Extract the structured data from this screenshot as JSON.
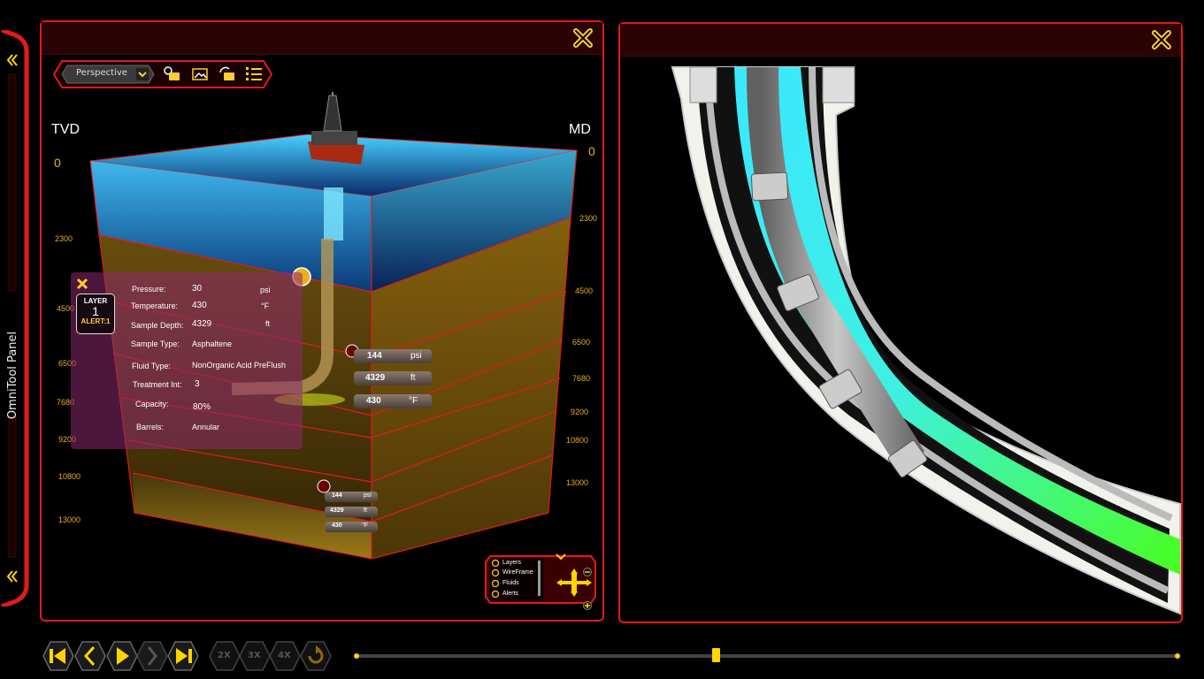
{
  "omnitool": {
    "label": "OmniTool Panel"
  },
  "left_panel": {
    "view_mode": {
      "selected": "Perspective"
    },
    "toolbar_icons": [
      "zoom-camera-icon",
      "image-icon",
      "rotate-camera-icon",
      "list-settings-icon"
    ],
    "tvd_label": "TVD",
    "md_label": "MD",
    "tvd_ticks": [
      "0",
      "2300",
      "4500",
      "6500",
      "7680",
      "9200",
      "10800",
      "13000"
    ],
    "md_ticks": [
      "0",
      "2300",
      "4500",
      "6500",
      "7680",
      "9200",
      "10800",
      "13000"
    ],
    "info_card": {
      "layer_label": "LAYER",
      "layer_number": "1",
      "alert": "ALERT:1",
      "fields": [
        {
          "label": "Pressure:",
          "value": "30",
          "unit": "psi"
        },
        {
          "label": "Temperature:",
          "value": "430",
          "unit": "°F"
        },
        {
          "label": "Sample Depth:",
          "value": "4329",
          "unit": "ft"
        },
        {
          "label": "Sample Type:",
          "value": "Asphaltene",
          "unit": ""
        },
        {
          "label": "Fluid Type:",
          "value": "NonOrganic Acid PreFlush",
          "unit": ""
        },
        {
          "label": "Treatment Int:",
          "value": "3",
          "unit": ""
        },
        {
          "label": "Capacity:",
          "value": "80%",
          "unit": ""
        },
        {
          "label": "Barrels:",
          "value": "Annular",
          "unit": ""
        }
      ]
    },
    "marker_a": {
      "pressure": "144",
      "pressure_unit": "psi",
      "depth": "4329",
      "depth_unit": "ft",
      "temp": "430",
      "temp_unit": "°F"
    },
    "marker_b": {
      "pressure": "144",
      "pressure_unit": "psi",
      "depth": "4329",
      "depth_unit": "ft",
      "temp": "430",
      "temp_unit": "°F"
    },
    "legend": {
      "items": [
        "Layers",
        "WireFrame",
        "Fluids",
        "Alerts"
      ]
    }
  },
  "playback": {
    "buttons": [
      "skip-back",
      "step-back",
      "play",
      "pause",
      "skip-forward"
    ],
    "speeds": [
      "2X",
      "3X",
      "4X"
    ],
    "position": 0.437
  },
  "colors": {
    "accent": "#e21a1a",
    "gold": "#e8b020",
    "header": "#2a0405",
    "fluid": "#38f0ff"
  }
}
